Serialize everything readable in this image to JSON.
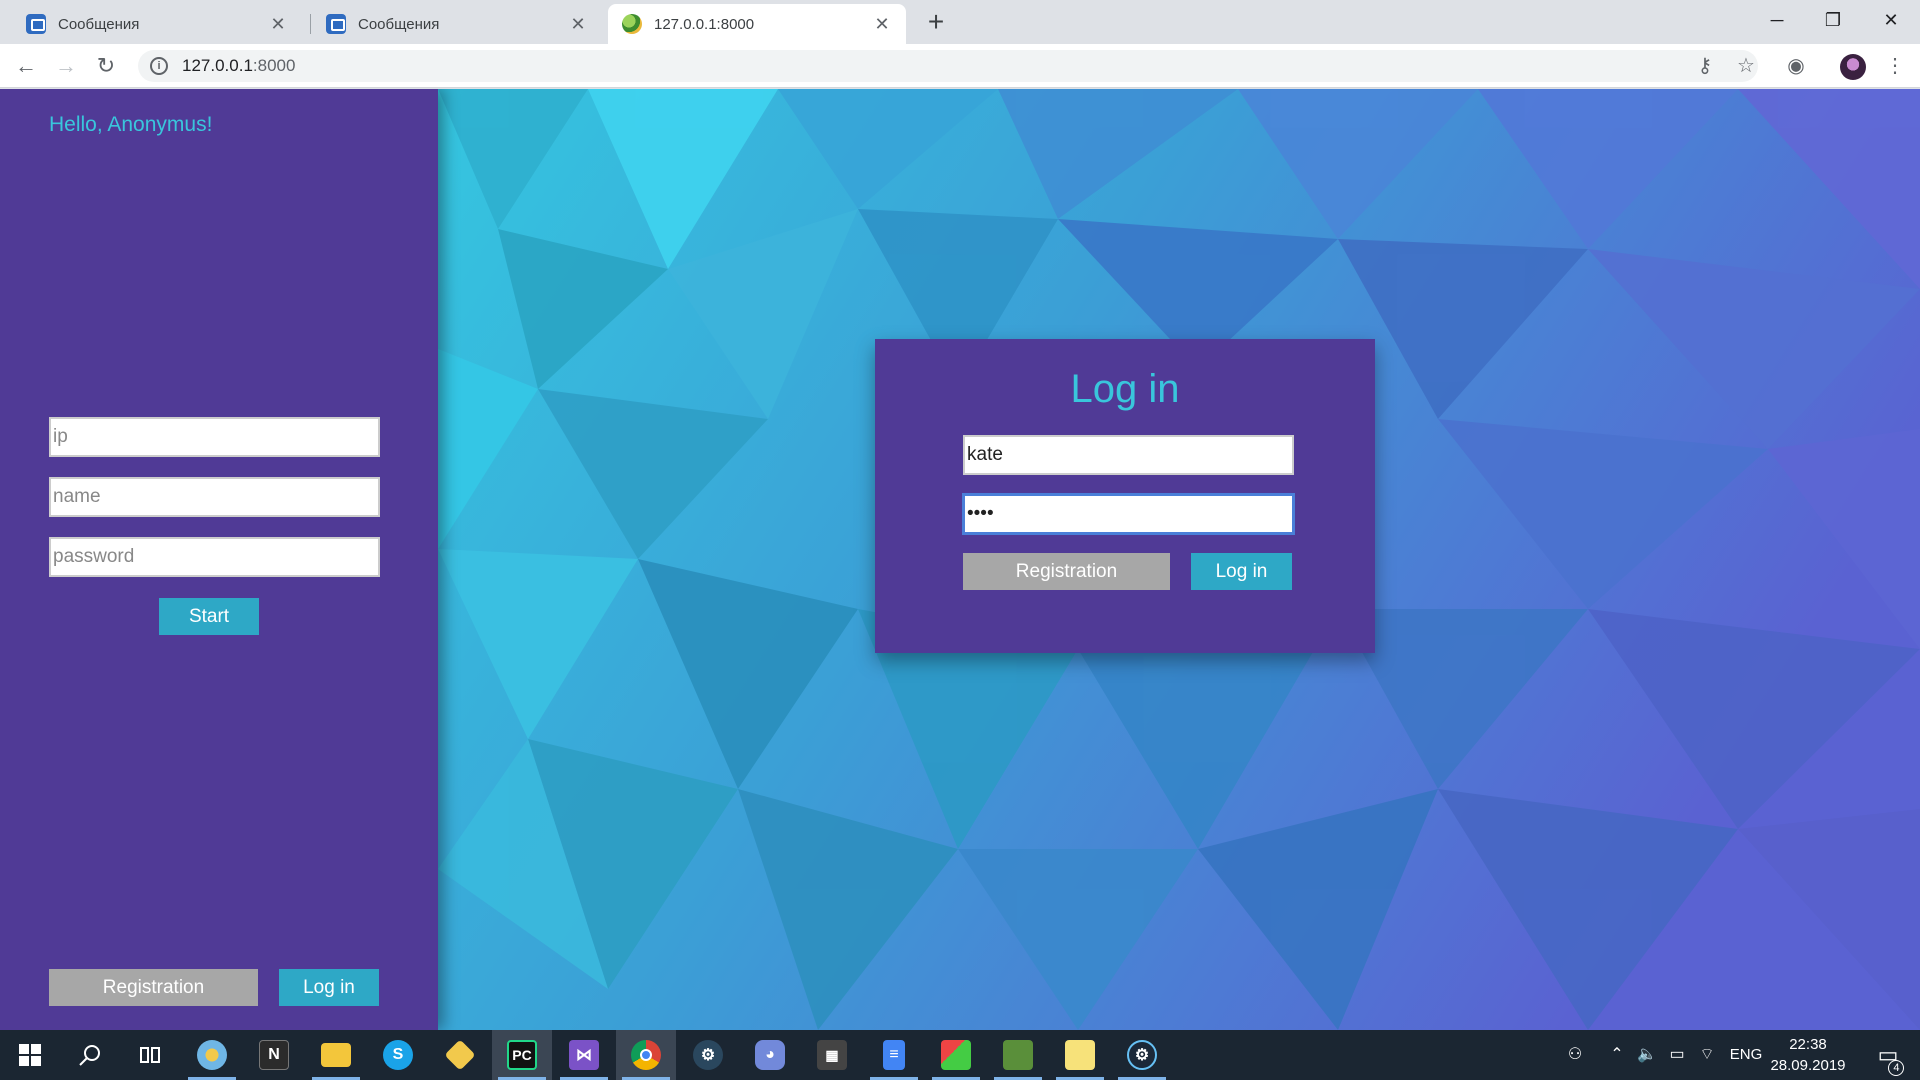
{
  "browser": {
    "tabs": [
      {
        "title": "Сообщения",
        "favicon": "vk-messages-icon"
      },
      {
        "title": "Сообщения",
        "favicon": "vk-messages-icon"
      },
      {
        "title": "127.0.0.1:8000",
        "favicon": "site-globe-icon",
        "active": true
      }
    ],
    "url_host": "127.0.0.1",
    "url_port": ":8000"
  },
  "sidebar": {
    "greeting": "Hello, Anonymus!",
    "ip_placeholder": "ip",
    "name_placeholder": "name",
    "password_placeholder": "password",
    "start_label": "Start",
    "registration_label": "Registration",
    "login_label": "Log in"
  },
  "login_card": {
    "title": "Log in",
    "username_value": "kate",
    "password_value": "••••",
    "registration_label": "Registration",
    "login_label": "Log in"
  },
  "colors": {
    "sidebar_bg": "#503a96",
    "accent_text": "#39c6dc",
    "button_teal": "#2ea8c6",
    "button_grey": "#a7a7a7"
  },
  "taskbar": {
    "language": "ENG",
    "time": "22:38",
    "date": "28.09.2019",
    "notifications": "4",
    "pinned": [
      "windows-start-icon",
      "search-icon",
      "task-view-icon",
      "paint-icon",
      "notion-icon",
      "file-explorer-icon",
      "skype-icon",
      "git-icon",
      "pycharm-icon",
      "visual-studio-icon",
      "chrome-icon",
      "steam-icon",
      "discord-icon",
      "calculator-icon",
      "docs-icon",
      "image-app-icon",
      "game-icon",
      "notepad-icon",
      "steam-icon"
    ]
  }
}
